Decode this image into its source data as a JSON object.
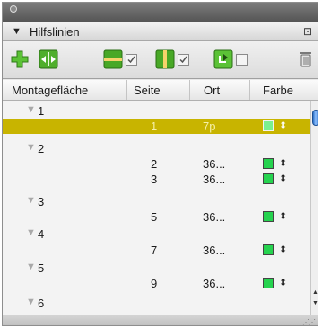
{
  "panel": {
    "title": "Hilfslinien",
    "tab_triangle": "▼",
    "menu_glyph": "⊡"
  },
  "toolbar": {
    "buttons": [
      {
        "name": "add-guide-button",
        "icon": "plus-icon"
      },
      {
        "name": "center-guides-button",
        "icon": "center-arrows-icon"
      },
      {
        "name": "horizontal-guides-button",
        "icon": "horizontal-guide-icon",
        "checked": true
      },
      {
        "name": "vertical-guides-button",
        "icon": "vertical-guide-icon",
        "checked": true
      },
      {
        "name": "snap-guides-button",
        "icon": "snap-icon",
        "checked": false
      },
      {
        "name": "delete-guide-button",
        "icon": "trash-icon"
      }
    ]
  },
  "columns": {
    "spread": "Montagefläche",
    "page": "Seite",
    "position": "Ort",
    "color": "Farbe"
  },
  "rows": [
    {
      "type": "spread",
      "label": "1"
    },
    {
      "type": "guide",
      "page": "1",
      "position": "7p",
      "selected": true
    },
    {
      "type": "spread",
      "label": "2"
    },
    {
      "type": "guide",
      "page": "2",
      "position": "36..."
    },
    {
      "type": "guide",
      "page": "3",
      "position": "36..."
    },
    {
      "type": "spread",
      "label": "3"
    },
    {
      "type": "guide",
      "page": "5",
      "position": "36..."
    },
    {
      "type": "spread",
      "label": "4"
    },
    {
      "type": "guide",
      "page": "7",
      "position": "36..."
    },
    {
      "type": "spread",
      "label": "5"
    },
    {
      "type": "guide",
      "page": "9",
      "position": "36..."
    },
    {
      "type": "spread",
      "label": "6"
    }
  ],
  "colors": {
    "selection": "#c8b400",
    "guide_swatch": "#26d34f"
  }
}
